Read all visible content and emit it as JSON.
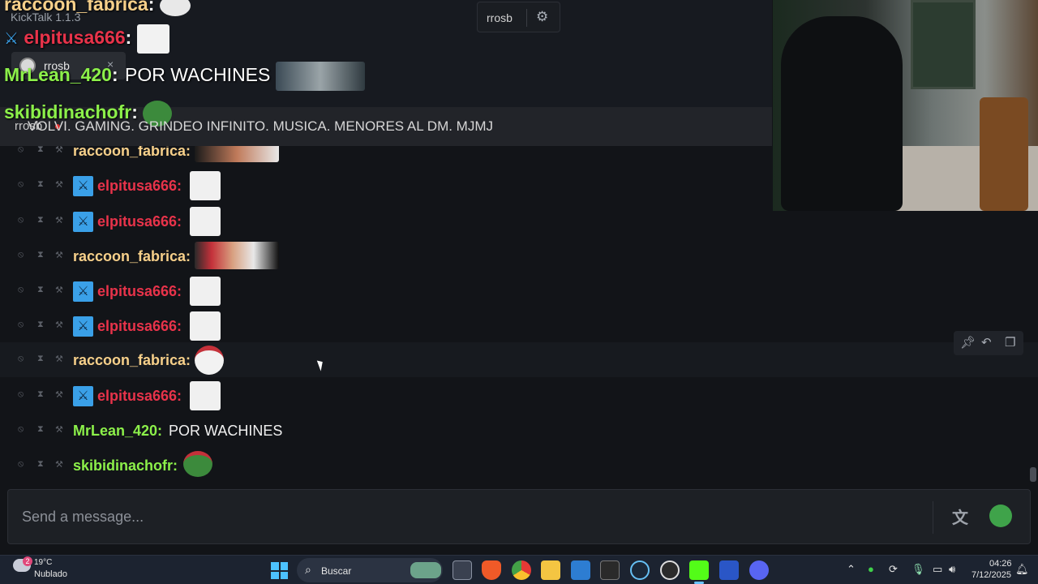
{
  "app": {
    "title": "KickTalk 1.1.3",
    "tab_label": "rrosb",
    "tab_close": "×"
  },
  "channel_switch": {
    "name": "rrosb"
  },
  "stream": {
    "streamer": "rrosb",
    "title": "VOLVI. GAMING. GRINDEO INFINITO. MUSICA. MENORES AL DM. MJMJ"
  },
  "overlay_chat": [
    {
      "user": "raccoon_fabrica",
      "color": "#f7d08a",
      "text": ""
    },
    {
      "user": "elpitusa666",
      "color": "#e8334a",
      "text": ""
    },
    {
      "user": "MrLean_420",
      "color": "#8cf04a",
      "text": "POR WACHINES"
    },
    {
      "user": "skibidinachofr",
      "color": "#8cf04a",
      "text": ""
    }
  ],
  "chat": {
    "colors": {
      "raccoon": "#f7d08a",
      "elpitusa": "#e8334a",
      "green": "#8cf04a"
    },
    "messages": [
      {
        "user": "raccoon_fabrica:",
        "text": ""
      },
      {
        "user": "elpitusa666:",
        "text": ""
      },
      {
        "user": "elpitusa666:",
        "text": ""
      },
      {
        "user": "raccoon_fabrica:",
        "text": ""
      },
      {
        "user": "elpitusa666:",
        "text": ""
      },
      {
        "user": "elpitusa666:",
        "text": ""
      },
      {
        "user": "raccoon_fabrica:",
        "text": ""
      },
      {
        "user": "elpitusa666:",
        "text": ""
      },
      {
        "user": "MrLean_420:",
        "text": "POR WACHINES"
      },
      {
        "user": "skibidinachofr:",
        "text": ""
      }
    ]
  },
  "input": {
    "placeholder": "Send a message..."
  },
  "taskbar": {
    "weather_temp": "19°C",
    "weather_desc": "Nublado",
    "weather_badge": "2",
    "search_label": "Buscar",
    "clock_time": "04:26",
    "clock_date": "7/12/2025"
  }
}
